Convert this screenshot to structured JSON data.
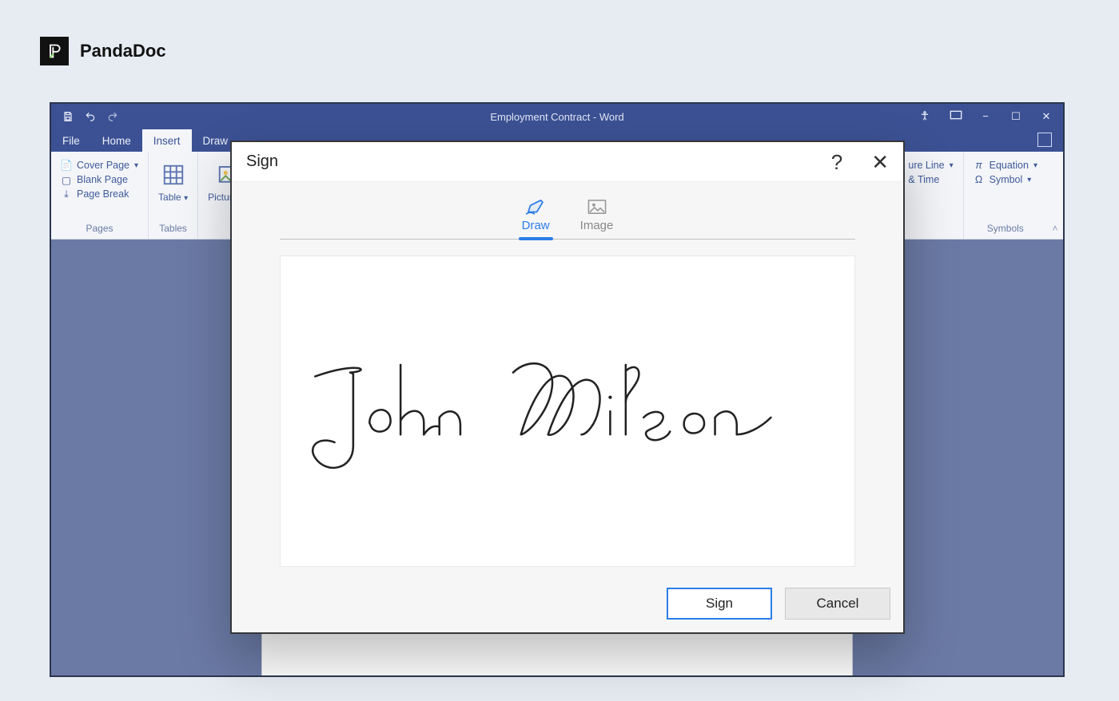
{
  "brand": {
    "name": "PandaDoc"
  },
  "word": {
    "titlebar": {
      "doc_title": "Employment Contract - Word",
      "qat": {
        "save": "save-icon",
        "undo": "undo-icon",
        "redo": "redo-icon"
      },
      "window_controls": {
        "min": "−",
        "max": "☐",
        "close": "✕"
      }
    },
    "menu": {
      "tabs": [
        "File",
        "Home",
        "Insert",
        "Draw"
      ],
      "active": "Insert"
    },
    "ribbon": {
      "pages": {
        "title": "Pages",
        "cover_page": "Cover Page",
        "blank_page": "Blank Page",
        "page_break": "Page Break"
      },
      "tables": {
        "title": "Tables",
        "table": "Table"
      },
      "illustrations": {
        "pictures": "Pictures"
      },
      "right1": {
        "sig_line": "ure Line",
        "time": "& Time"
      },
      "symbols": {
        "title": "Symbols",
        "equation": "Equation",
        "symbol": "Symbol"
      }
    }
  },
  "dialog": {
    "title": "Sign",
    "help_glyph": "?",
    "close_glyph": "✕",
    "tabs": {
      "draw": "Draw",
      "image": "Image",
      "active": "draw"
    },
    "signature_text": "John Wilson",
    "buttons": {
      "primary": "Sign",
      "secondary": "Cancel"
    }
  }
}
